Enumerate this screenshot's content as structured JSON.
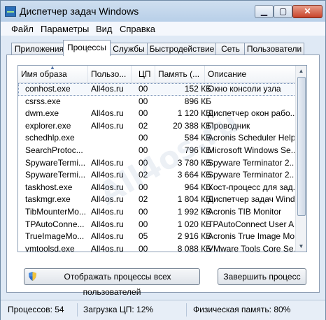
{
  "window": {
    "title": "Диспетчер задач Windows"
  },
  "menu": {
    "items": [
      "Файл",
      "Параметры",
      "Вид",
      "Справка"
    ]
  },
  "tabs": [
    {
      "label": "Приложения"
    },
    {
      "label": "Процессы"
    },
    {
      "label": "Службы"
    },
    {
      "label": "Быстродействие"
    },
    {
      "label": "Сеть"
    },
    {
      "label": "Пользователи"
    }
  ],
  "table": {
    "columns": [
      "Имя образа",
      "Пользо...",
      "ЦП",
      "Память (...",
      "Описание"
    ],
    "rows": [
      [
        "conhost.exe",
        "All4os.ru",
        "00",
        "152 КБ",
        "Окно консоли узла"
      ],
      [
        "csrss.exe",
        "",
        "00",
        "896 КБ",
        ""
      ],
      [
        "dwm.exe",
        "All4os.ru",
        "00",
        "1 120 КБ",
        "Диспетчер окон рабо..."
      ],
      [
        "explorer.exe",
        "All4os.ru",
        "02",
        "20 388 КБ",
        "Проводник"
      ],
      [
        "schedhlp.exe",
        "",
        "00",
        "584 КБ",
        "Acronis Scheduler Helper"
      ],
      [
        "SearchProtoc...",
        "",
        "00",
        "796 КБ",
        "Microsoft Windows Se..."
      ],
      [
        "SpywareTermi...",
        "All4os.ru",
        "00",
        "3 780 КБ",
        "Spyware Terminator 2..."
      ],
      [
        "SpywareTermi...",
        "All4os.ru",
        "02",
        "3 664 КБ",
        "Spyware Terminator 2..."
      ],
      [
        "taskhost.exe",
        "All4os.ru",
        "00",
        "964 КБ",
        "Хост-процесс для зад..."
      ],
      [
        "taskmgr.exe",
        "All4os.ru",
        "02",
        "1 804 КБ",
        "Диспетчер задач Windo..."
      ],
      [
        "TibMounterMo...",
        "All4os.ru",
        "00",
        "1 992 КБ",
        "Acronis TIB Monitor"
      ],
      [
        "TPAutoConne...",
        "All4os.ru",
        "00",
        "1 020 КБ",
        "TPAutoConnect User A..."
      ],
      [
        "TrueImageMo...",
        "All4os.ru",
        "05",
        "2 916 КБ",
        "Acronis True Image Mo..."
      ],
      [
        "vmtoolsd.exe",
        "All4os.ru",
        "00",
        "8 088 КБ",
        "VMware Tools Core Se..."
      ]
    ]
  },
  "buttons": {
    "show_all": "Отображать процессы всех пользователей",
    "end_process": "Завершить процесс"
  },
  "status": {
    "processes": "Процессов: 54",
    "cpu": "Загрузка ЦП: 12%",
    "memory": "Физическая память: 80%"
  },
  "watermark": "All4os.ru",
  "colors": {
    "accent": "#2b6fb8",
    "close": "#c8432b"
  }
}
